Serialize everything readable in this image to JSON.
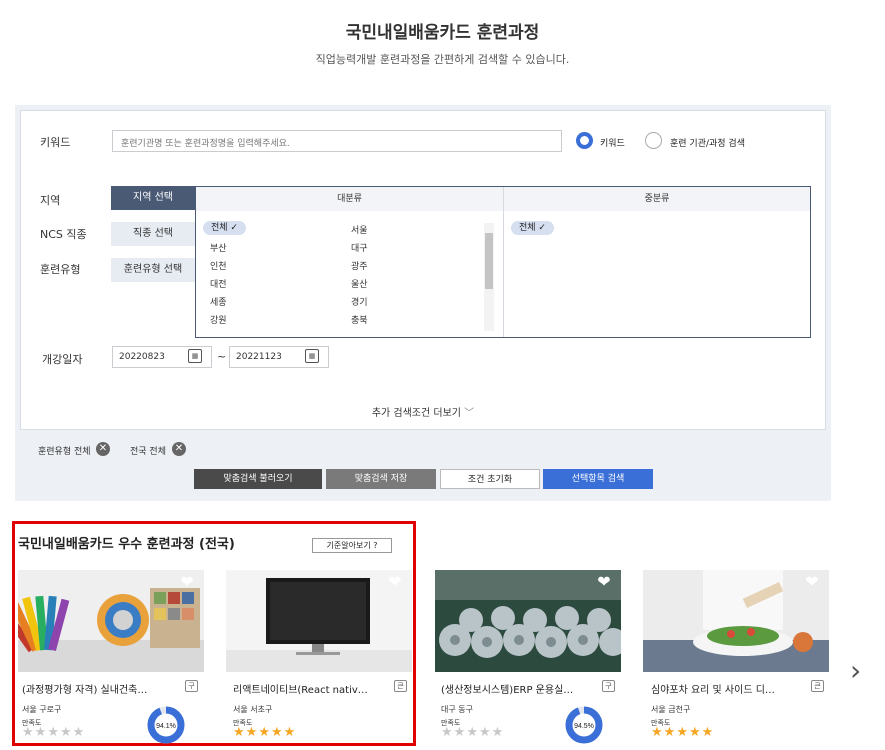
{
  "header": {
    "title": "국민내일배움카드 훈련과정",
    "subtitle": "직업능력개발 훈련과정을 간편하게 검색할 수 있습니다."
  },
  "search": {
    "keyword_label": "키워드",
    "keyword_placeholder": "훈련기관명 또는 훈련과정명을 입력해주세요.",
    "radio_keyword": "키워드",
    "radio_institution": "훈련 기관/과정 검색",
    "region_label": "지역",
    "ncs_label": "NCS 직종",
    "type_label": "훈련유형",
    "region_btn": "지역 선택",
    "ncs_btn": "직종 선택",
    "type_btn": "훈련유형 선택",
    "major_header": "대분류",
    "minor_header": "중분류",
    "regions_left": [
      "전체",
      "부산",
      "인천",
      "대전",
      "세종",
      "강원"
    ],
    "regions_right": [
      "서울",
      "대구",
      "광주",
      "울산",
      "경기",
      "충북"
    ],
    "minor_selected": "전체",
    "date_label": "개강일자",
    "date_from": "20220823",
    "date_to": "20221123",
    "date_sep": "~",
    "more_label": "추가 검색조건 더보기"
  },
  "filters": {
    "tags": [
      "훈련유형 전체",
      "전국 전체"
    ],
    "buttons": [
      "맞춤검색 불러오기",
      "맞춤검색 저장",
      "조건 초기화",
      "선택항목 검색"
    ]
  },
  "best": {
    "title": "국민내일배움카드 우수 훈련과정 (전국)",
    "criteria_btn": "기준알아보기 ?",
    "cards": [
      {
        "name": "(과정평가형 자격) 실내건축…",
        "badge": "구",
        "location": "서울 구로구",
        "satisfaction_label": "만족도",
        "stars": 0,
        "donut": "94.1%",
        "donut_value": 94.1
      },
      {
        "name": "리액트네이티브(React nativ…",
        "badge": "큰",
        "location": "서울 서초구",
        "satisfaction_label": "만족도",
        "stars": 5,
        "donut": null
      },
      {
        "name": "(생산정보시스템)ERP 운용실…",
        "badge": "구",
        "location": "대구 동구",
        "satisfaction_label": "만족도",
        "stars": 0,
        "donut": "94.5%",
        "donut_value": 94.5
      },
      {
        "name": "심야포차 요리 및 사이드 디…",
        "badge": "큰",
        "location": "서울 금천구",
        "satisfaction_label": "만족도",
        "stars": 5,
        "donut": null
      }
    ]
  },
  "colors": {
    "accent": "#3a6fd8",
    "dark_btn": "#4a4a4a",
    "gray_btn": "#7a7a7a",
    "blue_btn": "#3a6fd8",
    "star_on": "#f5a623",
    "star_off": "#c8c8c8",
    "highlight": "#e00000"
  }
}
